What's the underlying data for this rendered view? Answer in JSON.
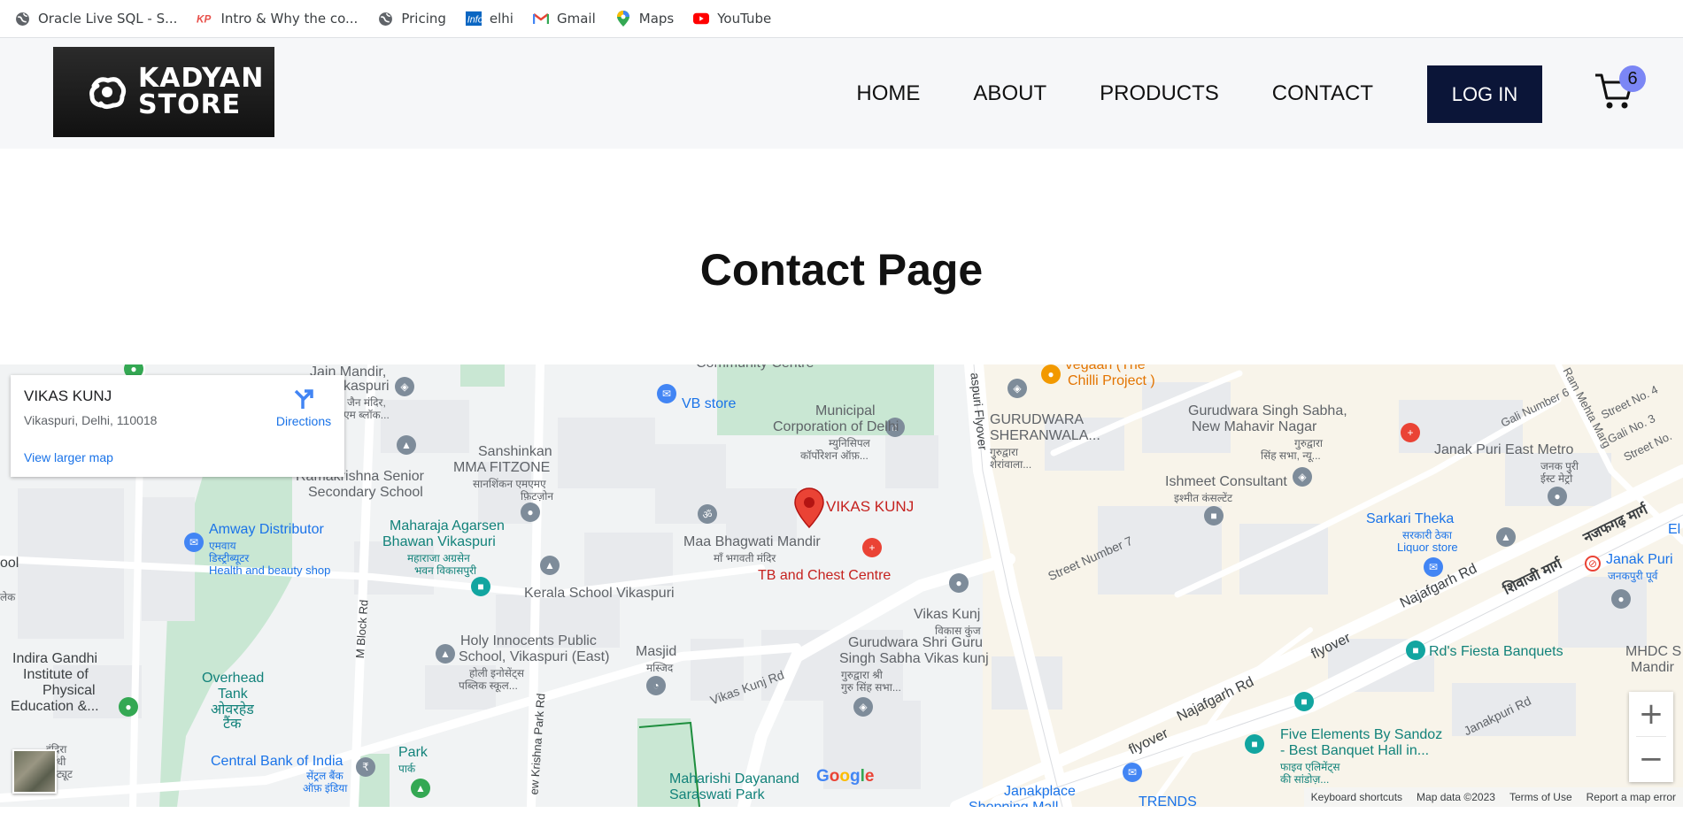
{
  "bookmarks": [
    {
      "label": "Oracle Live SQL - S...",
      "icon": "globe-icon"
    },
    {
      "label": "Intro & Why the co...",
      "icon": "kp-icon"
    },
    {
      "label": "Pricing",
      "icon": "globe-icon"
    },
    {
      "label": "elhi",
      "icon": "info-icon"
    },
    {
      "label": "Gmail",
      "icon": "gmail-icon"
    },
    {
      "label": "Maps",
      "icon": "maps-icon"
    },
    {
      "label": "YouTube",
      "icon": "youtube-icon"
    }
  ],
  "header": {
    "logo_line1": "KADYAN",
    "logo_line2": "STORE",
    "nav": [
      "HOME",
      "ABOUT",
      "PRODUCTS",
      "CONTACT"
    ],
    "login_label": "LOG IN",
    "cart_count": "6"
  },
  "main": {
    "title": "Contact Page"
  },
  "map": {
    "place_name": "VIKAS KUNJ",
    "place_address": "Vikaspuri, Delhi, 110018",
    "directions_label": "Directions",
    "larger_map_label": "View larger map",
    "marker_label": "VIKAS KUNJ",
    "zoom_in": "+",
    "zoom_out": "−",
    "google_logo": "Google",
    "footer": [
      "Keyboard shortcuts",
      "Map data ©2023",
      "Terms of Use",
      "Report a map error"
    ],
    "labels": [
      "VB store",
      "Municipal",
      "Corporation of Delhi",
      "म्युनिसिपल",
      "कॉर्पोरेशन ऑफ़...",
      "Sanshinkan",
      "MMA FITZONE",
      "सानशिंकन एमएमए",
      "फ़िटज़ोन",
      "Ramakrishna Senior",
      "Secondary School",
      "Maharaja Agarsen",
      "Bhawan Vikaspuri",
      "महाराजा अग्रसेन",
      "भवन विकासपुरी",
      "Amway Distributor",
      "एमवाय",
      "डिस्ट्रीब्यूटर",
      "Health and beauty shop",
      "Maa Bhagwati Mandir",
      "माँ भगवती मंदिर",
      "TB and Chest Centre",
      "Kerala School Vikaspuri",
      "Holy Innocents Public",
      "School, Vikaspuri (East)",
      "होली इनोसेंट्स",
      "पब्लिक स्कूल...",
      "Masjid",
      "मस्जिद",
      "Gurudwara Shri Guru",
      "Singh Sabha Vikas kunj",
      "गुरुद्वारा श्री",
      "गुरु सिंह सभा...",
      "Vikas Kunj",
      "विकास कुंज",
      "Indira Gandhi",
      "Institute of",
      "Physical",
      "Education &...",
      "Overhead",
      "Tank",
      "ओवरहेड",
      "टैंक",
      "Central Bank of India",
      "सेंट्रल बैंक",
      "ऑफ़ इंडिया",
      "Park",
      "पार्क",
      "Maharishi Dayanand",
      "Saraswati Park",
      "GURUDWARA",
      "SHERANWALA...",
      "गुरुद्वारा",
      "शेरांवाला...",
      "Gurudwara Singh Sabha,",
      "New Mahavir Nagar",
      "गुरुद्वारा",
      "सिंह सभा, न्यू...",
      "Ishmeet Consultant",
      "इश्मीत कंसल्टेंट",
      "Janak Puri East Metro",
      "जनक पुरी",
      "ईस्ट मेट्रो",
      "Sarkari Theka",
      "सरकारी ठेका",
      "Liquor store",
      "Janak Puri",
      "जनकपुरी पूर्व",
      "Rd's Fiesta Banquets",
      "Five Elements By Sandoz",
      "- Best Banquet Hall in...",
      "फाइव एलिमेंट्स",
      "की सांडोज़...",
      "MHDC S",
      "Mandir",
      "Vegaan (The",
      "Chilli Project )",
      "Jain Mandir,",
      "kaspuri",
      "जैन मंदिर,",
      "एम ब्लॉक...",
      "Community Centre",
      "Janakplace",
      "Shopping Mall",
      "TRENDS",
      "Street Number 7",
      "Vikas Kunj Rd",
      "Najafgarh Rd",
      "flyover",
      "Janakpuri Rd",
      "नजफगढ़ मार्ग",
      "शिवाजी मार्ग",
      "Gali Number 6",
      "Street No. 4",
      "Gali No. 3",
      "Street No.",
      "Ram Mehta Marg",
      "aspuri Flyover",
      "M Block Rd",
      "ew Krishna Park Rd",
      "इंदिरा",
      "गाँधी",
      "इंस्टिट्यूट",
      "ool",
      "लेक",
      "El"
    ]
  },
  "colors": {
    "nav_bg": "#f6f7f9",
    "login_bg": "#0b1538",
    "badge_bg": "#7b86f5",
    "map_bg": "#f1f3f4",
    "park": "#c9e7d3",
    "marker": "#ea4335"
  }
}
